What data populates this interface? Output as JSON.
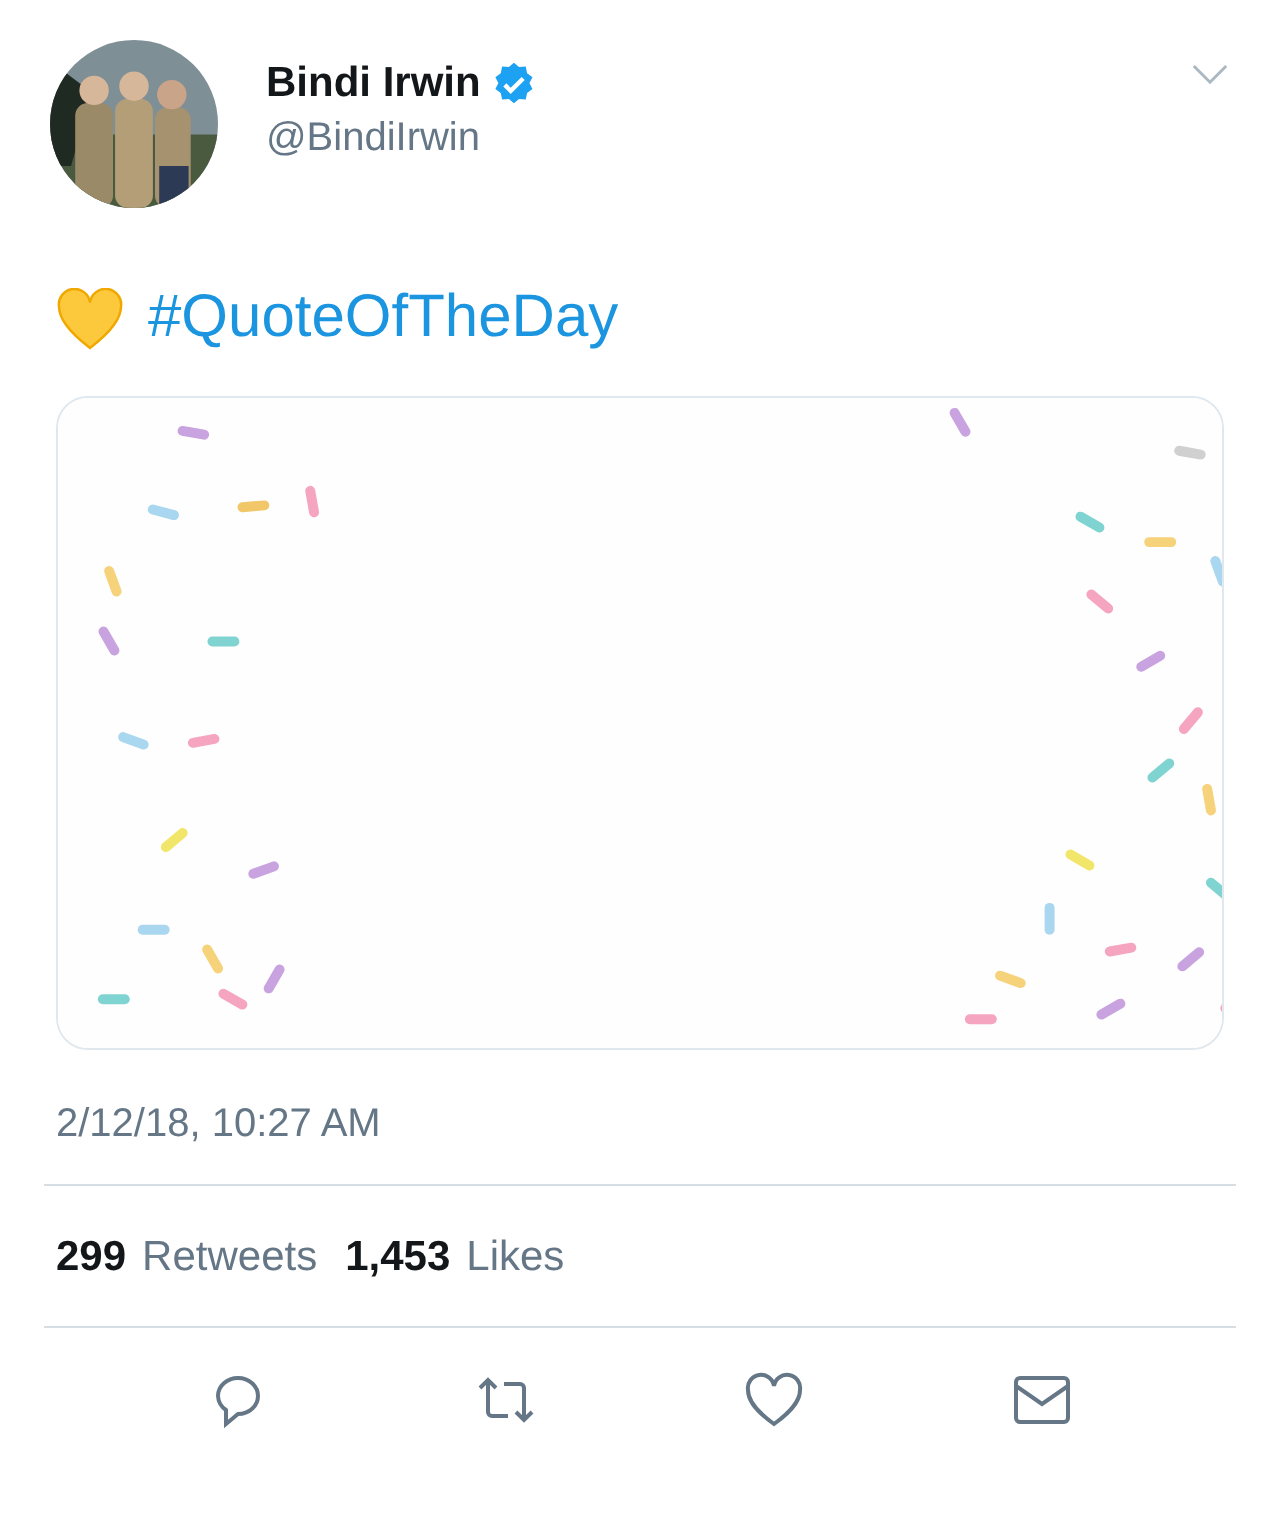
{
  "author": {
    "name": "Bindi Irwin",
    "verified": true,
    "handle": "@BindiIrwin"
  },
  "tweet": {
    "hashtag": "#QuoteOfTheDay",
    "timestamp": "2/12/18, 10:27 AM"
  },
  "stats": [
    {
      "count": "299",
      "label": "Retweets"
    },
    {
      "count": "1,453",
      "label": "Likes"
    }
  ],
  "actions": [
    {
      "kind": "reply"
    },
    {
      "kind": "retweet"
    },
    {
      "kind": "like"
    },
    {
      "kind": "message"
    }
  ]
}
